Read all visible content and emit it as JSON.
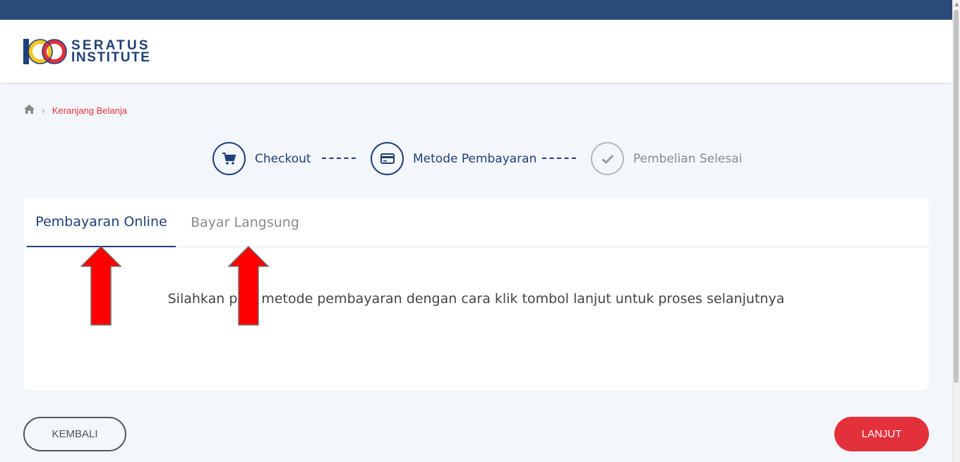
{
  "brand": {
    "line1": "SERATUS",
    "line2": "INSTITUTE",
    "colors": {
      "navy": "#1f3f79",
      "red": "#e3313c",
      "yellow": "#f7c623"
    }
  },
  "breadcrumb": {
    "home_icon": "home-icon",
    "separator": "›",
    "current": "Keranjang Belanja"
  },
  "steps": [
    {
      "label": "Checkout",
      "icon": "cart-icon",
      "state": "done"
    },
    {
      "label": "Metode Pembayaran",
      "icon": "credit-card-icon",
      "state": "current"
    },
    {
      "label": "Pembelian Selesai",
      "icon": "check-icon",
      "state": "pending"
    }
  ],
  "step_connector": "--------",
  "tabs": [
    {
      "label": "Pembayaran Online",
      "active": true
    },
    {
      "label": "Bayar Langsung",
      "active": false
    }
  ],
  "message": "Silahkan pilih metode pembayaran dengan cara klik tombol lanjut untuk proses selanjutnya",
  "buttons": {
    "back": "KEMBALI",
    "next": "LANJUT"
  },
  "annotations": {
    "arrow_color": "#ff0000"
  }
}
